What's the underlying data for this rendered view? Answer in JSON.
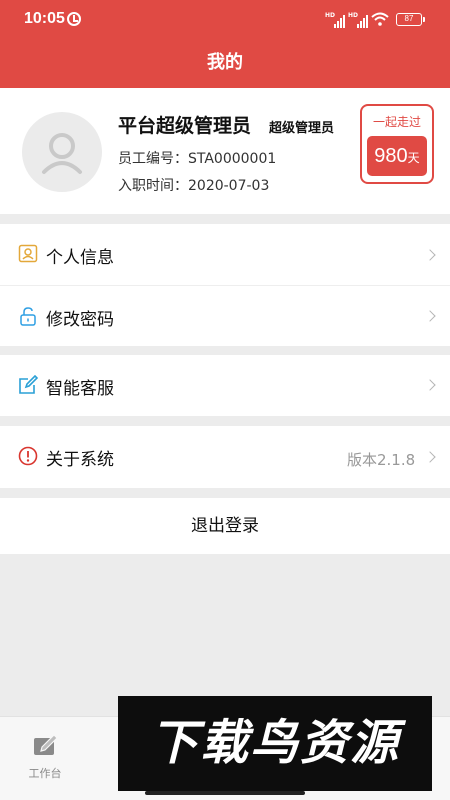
{
  "status_bar": {
    "time": "10:05",
    "signal_1_label": "HD",
    "signal_2_label": "HD",
    "battery": "87"
  },
  "header": {
    "title": "我的"
  },
  "profile": {
    "name": "平台超级管理员",
    "role": "超级管理员",
    "employee_id_label": "员工编号：",
    "employee_id": "STA0000001",
    "join_date_label": "入职时间：",
    "join_date": "2020-07-03",
    "together_caption": "一起走过",
    "days_value": "980",
    "days_unit": "天"
  },
  "menu": {
    "personal_info": "个人信息",
    "change_password": "修改密码",
    "customer_service": "智能客服",
    "about_system": "关于系统",
    "version": "版本2.1.8"
  },
  "logout": {
    "label": "退出登录"
  },
  "tabbar": {
    "workbench": "工作台"
  },
  "watermark": {
    "text": "下载鸟资源"
  },
  "colors": {
    "brand": "#e04a44",
    "background": "#ececec",
    "muted": "#999999"
  },
  "icons": {
    "personal_info": "user-badge-icon",
    "change_password": "unlock-icon",
    "customer_service": "edit-icon",
    "about_system": "info-icon",
    "workbench": "edit-icon"
  }
}
